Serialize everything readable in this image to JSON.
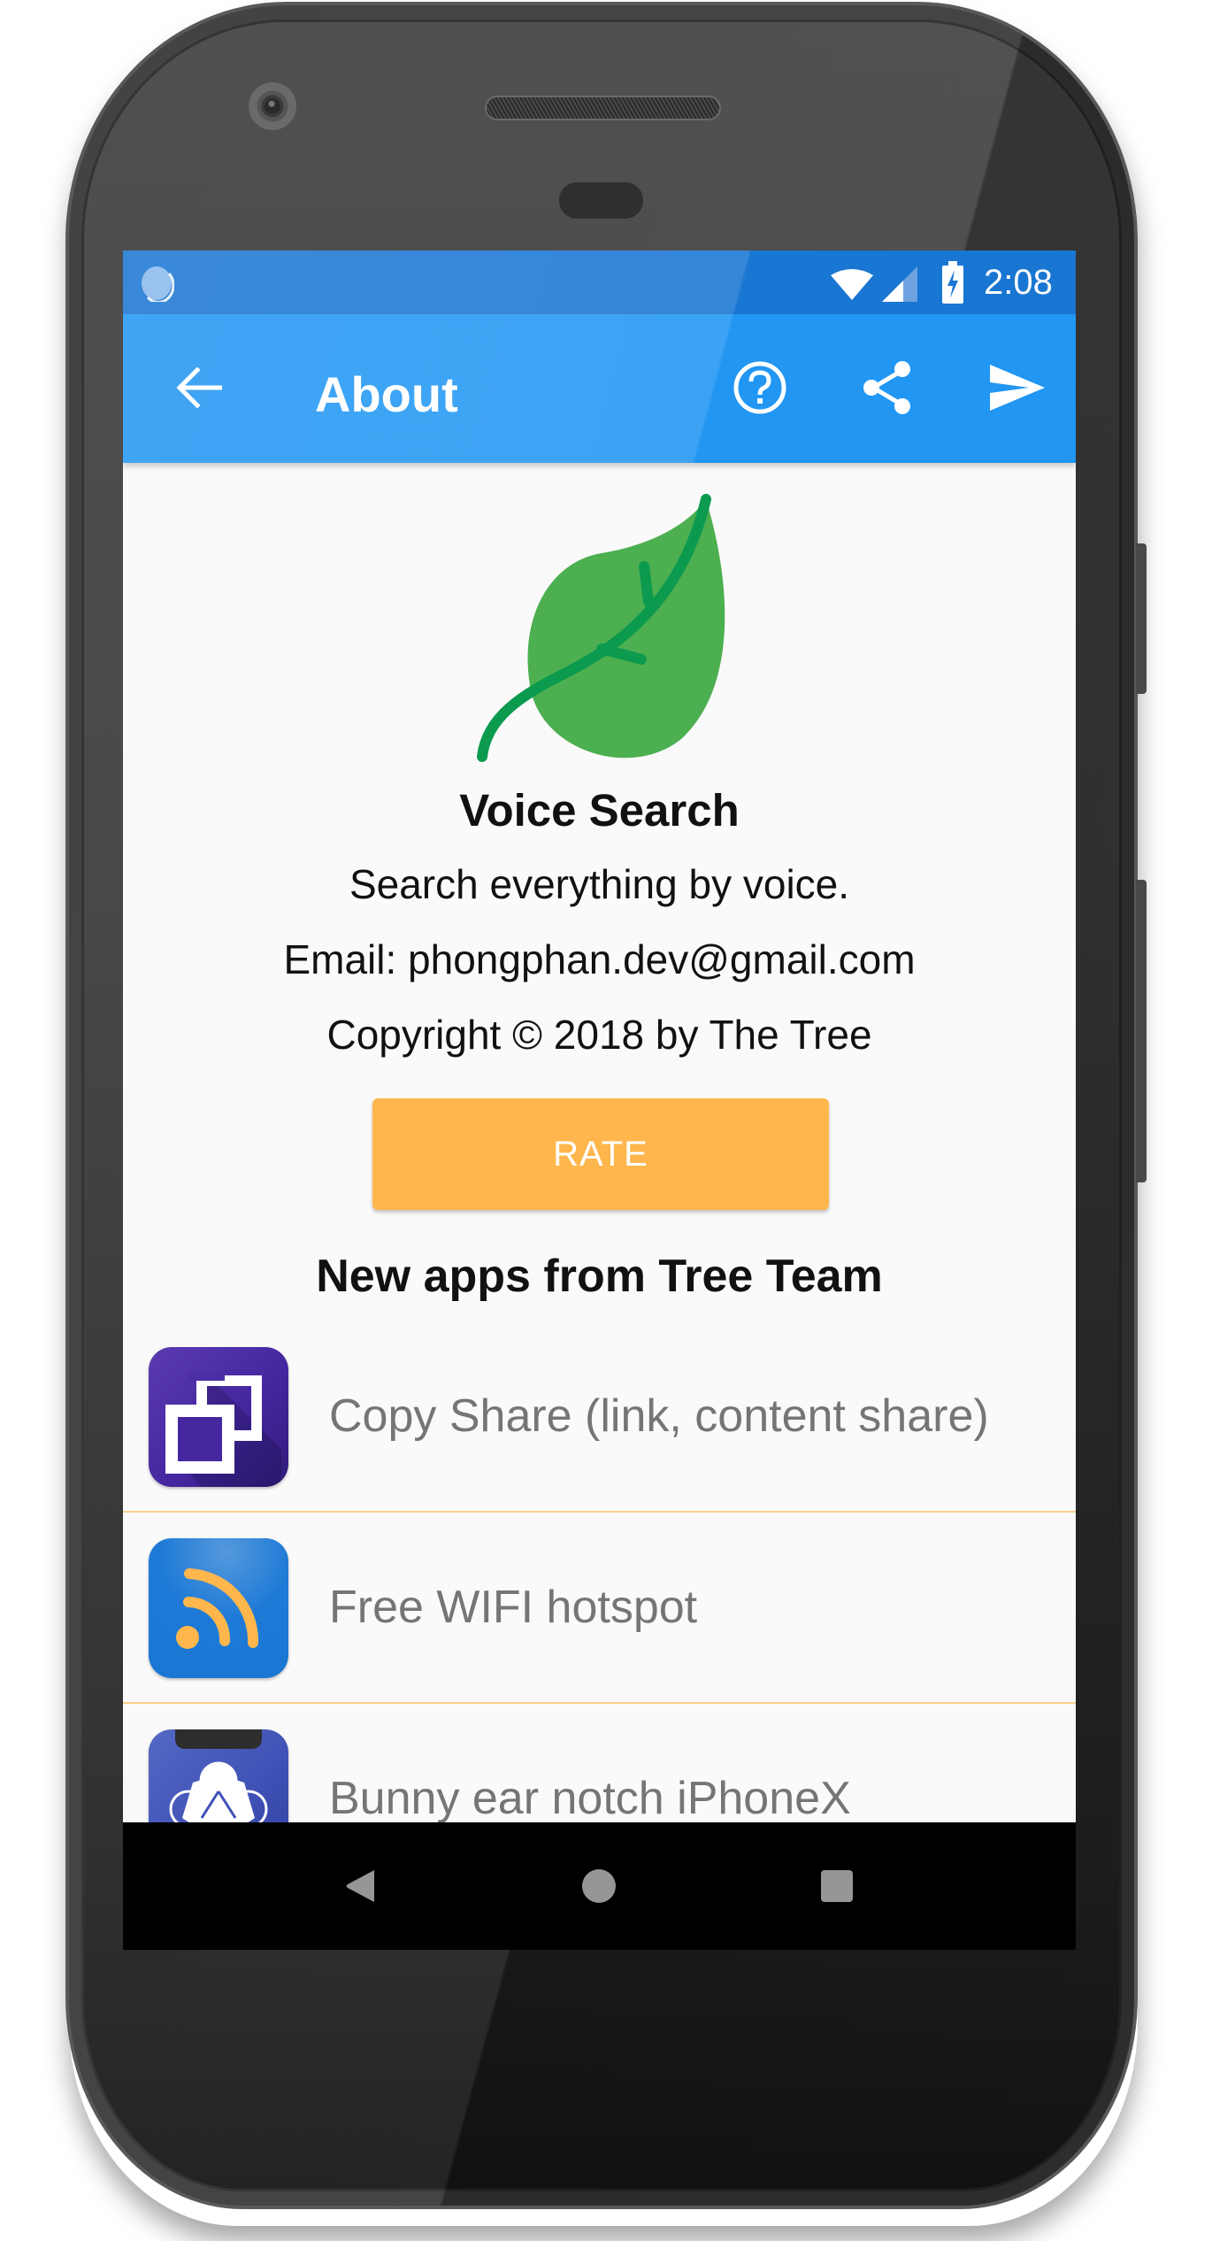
{
  "status_bar": {
    "left_icon": "sync-loading-icon",
    "icons": [
      "wifi-icon",
      "cell-signal-icon",
      "battery-charging-icon"
    ],
    "time": "2:08"
  },
  "app_bar": {
    "back_icon": "arrow-left-icon",
    "title": "About",
    "actions": [
      {
        "name": "help",
        "icon": "help-circle-icon"
      },
      {
        "name": "share",
        "icon": "share-icon"
      },
      {
        "name": "send",
        "icon": "send-icon"
      }
    ]
  },
  "about": {
    "logo_icon": "leaf-icon",
    "app_name": "Voice Search",
    "tagline": "Search everything by voice.",
    "email": "Email: phongphan.dev@gmail.com",
    "copyright": "Copyright © 2018 by The Tree",
    "rate_label": "RATE"
  },
  "more_apps": {
    "title": "New apps from Tree Team",
    "items": [
      {
        "label": "Copy Share (link, content share)",
        "icon": "copy-share-app-icon"
      },
      {
        "label": "Free WIFI hotspot",
        "icon": "wifi-hotspot-app-icon"
      },
      {
        "label": "Bunny ear notch iPhoneX",
        "icon": "bunny-ear-notch-app-icon"
      }
    ]
  },
  "nav_bar": {
    "back": "nav-back-icon",
    "home": "nav-home-icon",
    "recents": "nav-recents-icon"
  },
  "colors": {
    "status_bar": "#1976d2",
    "app_bar": "#2196f3",
    "rate_button": "#ffb74d",
    "leaf": "#4caf50",
    "leaf_vein": "#0c9a4f",
    "divider": "#f6cf8c",
    "list_text": "#757575"
  }
}
